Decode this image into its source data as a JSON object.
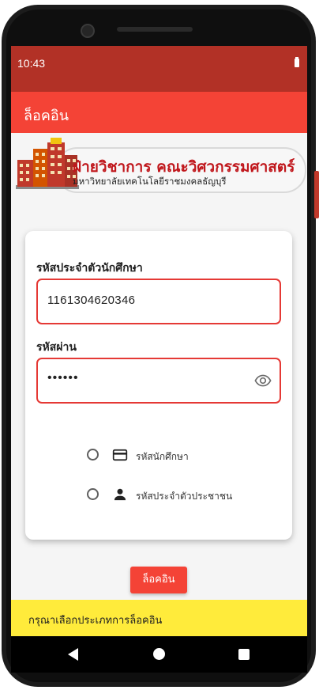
{
  "status_bar": {
    "time": "10:43"
  },
  "app_bar": {
    "title": "ล็อคอิน"
  },
  "banner": {
    "title": "ฝ่ายวิชาการ คณะวิศวกรรมศาสตร์",
    "subtitle": "มหาวิทยาลัยเทคโนโลยีราชมงคลธัญบุรี"
  },
  "form": {
    "student_id_label": "รหัสประจำตัวนักศึกษา",
    "student_id_value": "1161304620346",
    "password_label": "รหัสผ่าน",
    "password_value": "••••••",
    "login_types": [
      {
        "label": "รหัสนักศึกษา",
        "icon": "credit-card-icon",
        "selected": false
      },
      {
        "label": "รหัสประจำตัวประชาชน",
        "icon": "person-icon",
        "selected": false
      }
    ]
  },
  "login_button": {
    "label": "ล็อคอิน"
  },
  "snackbar": {
    "message": "กรุณาเลือกประเภทการล็อคอิน"
  },
  "colors": {
    "status_bar": "#b23126",
    "app_bar": "#f44336",
    "field_border": "#e53935",
    "snackbar": "#ffeb3b",
    "banner_title": "#c0161b"
  }
}
